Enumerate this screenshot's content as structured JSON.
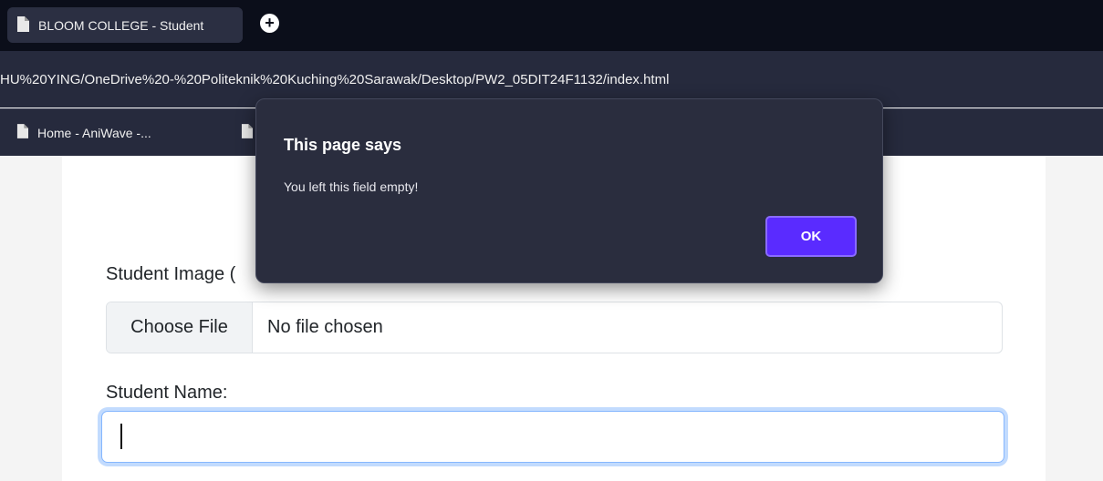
{
  "browser": {
    "tab_title": "BLOOM COLLEGE - Student",
    "new_tab_icon": "+",
    "address": "HU%20YING/OneDrive%20-%20Politeknik%20Kuching%20Sarawak/Desktop/PW2_05DIT24F1132/index.html",
    "bookmarks": [
      {
        "label": "Home - AniWave -..."
      },
      {
        "label": ""
      }
    ]
  },
  "form": {
    "image_label": "Student Image (",
    "file_button": "Choose File",
    "file_status": "No file chosen",
    "name_label": "Student Name:",
    "name_value": ""
  },
  "dialog": {
    "title": "This page says",
    "message": "You left this field empty!",
    "ok_label": "OK"
  },
  "colors": {
    "tabbar": "#0b0e1a",
    "toolbar": "#262a3d",
    "dialog_bg": "#2a2d3e",
    "ok_button": "#5a2bff",
    "focus_ring": "#86b7fe"
  }
}
